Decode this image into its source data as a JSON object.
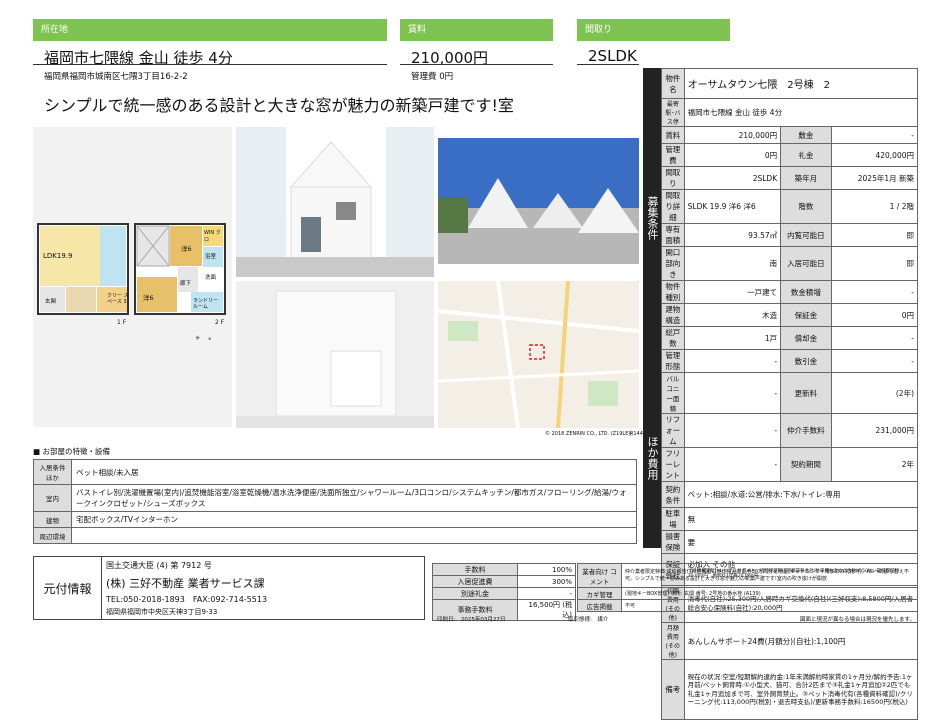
{
  "header": {
    "location_tab": "所在地",
    "rent_tab": "賃料",
    "layout_tab": "間取り",
    "station": "福岡市七隈線 金山 徒歩 4分",
    "address": "福岡県福岡市城南区七隈3丁目16-2-2",
    "rent": "210,000円",
    "mgmt_fee": "管理費 0円",
    "layout": "2SLDK",
    "catch_copy": "シンプルで統一感のある設計と大きな窓が魅力の新築戸建です!室"
  },
  "floorplan": {
    "ldk": "LDK19.9",
    "room_a": "洋6",
    "room_b": "洋6",
    "win": "WIN クロ",
    "bath": "浴室",
    "lav": "洗面",
    "hall": "廊下",
    "laundry": "ランドリー ルーム",
    "closet": "クリー スペース 3",
    "entrance": "玄関",
    "floor1": "1 F",
    "floor2": "2 F"
  },
  "map": {
    "copyright": "© 2018 ZENRIN CO., LTD. (Z19LE第1442号)"
  },
  "spec_labels": {
    "property_name": "物件名",
    "station": "最寄駅･バス停",
    "rent": "賃料",
    "deposit": "敷金",
    "mgmt": "管理費",
    "key_money": "礼金",
    "layout": "間取り",
    "built": "築年月",
    "layout_detail": "間取り詳細",
    "floor": "階数",
    "area": "専有面積",
    "preview": "内覧可能日",
    "opening": "開口部向き",
    "move_in": "入居可能日",
    "type": "物件種別",
    "units": "数金積増",
    "structure": "建物構造",
    "guarantee": "保証金",
    "total_units": "総戸数",
    "amortize": "償却金",
    "mgmt_form": "管理形態",
    "deduction": "敷引金",
    "balcony": "バルコニー面積",
    "renewal_fee": "更新料",
    "reform": "リフォーム",
    "brokerage": "仲介手数料",
    "free_rent": "フリーレント",
    "contract_period": "契約期間",
    "contract_terms": "契約条件",
    "parking": "駐車場",
    "insurance": "損害保険",
    "guarantor": "保証会社",
    "initial_cost": "初期費用(その他)",
    "monthly_cost": "月額費用(その他)",
    "remarks": "備考",
    "recruit_terms": "募集条件",
    "other_costs": "ほか費用"
  },
  "spec": {
    "property_name": "オーサムタウン七隈　2号棟　2",
    "station": "福岡市七隈線 金山 徒歩 4分",
    "rent": "210,000円",
    "deposit": "-",
    "mgmt": "0円",
    "key_money": "420,000円",
    "layout": "2SLDK",
    "built": "2025年1月 新築",
    "layout_detail": "SLDK 19.9 洋6 洋6",
    "floor": "1 / 2階",
    "area": "93.57㎡",
    "preview": "即",
    "opening": "南",
    "move_in": "即",
    "type": "一戸建て",
    "units": "-",
    "structure": "木造",
    "guarantee": "0円",
    "total_units": "1戸",
    "amortize": "-",
    "mgmt_form": "-",
    "deduction": "-",
    "balcony": "-",
    "renewal_fee": "(2年)",
    "reform": "-",
    "brokerage": "231,000円",
    "free_rent": "-",
    "contract_period": "2年",
    "contract_terms": "ペット:相談/水道:公営/排水:下水/トイレ:専用",
    "parking": "無",
    "insurance": "要",
    "guarantor": "必加入 その他",
    "guarantor_note": "【総額保証料】レジアルサポート：初回保証料は月額賃料合計(駐車場も含めた合計)の50%、最低保証料30,000円　更新料1年毎20,000円",
    "initial_cost": "消毒代(自社):25,300円/入居時カギ交換代(自社)(三好収支):8,5800円/入居者総合安心保険料(自社):20,000円",
    "monthly_cost": "あんしんサポート24費(月額分)(自社):1,100円",
    "remarks": "現在の状況:空室/短期解約違約金:1年未満解約時家賃の1ヶ月分/解約予告:1ヶ月前/ペット飼育時:①小型犬、猫可、合計2匹まで③礼金1ヶ月追加②2匹でも礼金1ヶ月追加まで可、室外飼育禁止。③ペット消毒代有(各種資料確認)/クリーニング代:113,000円(税別・退去時支払)/更新事務手数料:16500円(税込)"
  },
  "features": {
    "heading": "■ お部屋の特徴・設備",
    "rows": [
      {
        "label": "入居条件ほか",
        "value": "ペット相談/未入居"
      },
      {
        "label": "室内",
        "value": "バストイレ別/洗濯機置場(室内)/追焚機能浴室/浴室乾燥機/温水洗浄便座/洗面所独立/シャワールーム/3口コンロ/システムキッチン/都市ガス/フローリング/給湯/ウォークインクロゼット/シューズボックス"
      },
      {
        "label": "建物",
        "value": "宅配ボックス/TVインターホン"
      },
      {
        "label": "周辺環境",
        "value": ""
      }
    ]
  },
  "agent": {
    "label": "元付情報",
    "license": "国土交通大臣 (4) 第 7912 号",
    "company": "(株) 三好不動産 業者サービス課",
    "tel": "TEL:050-2018-1893　FAX:092-714-5513",
    "address": "福岡県福岡市中央区天神3丁目9-33"
  },
  "fees": [
    {
      "label": "手数料",
      "value": "100%"
    },
    {
      "label": "入居促進費",
      "value": "300%"
    },
    {
      "label": "別途礼金",
      "value": "-"
    },
    {
      "label": "事務手数料",
      "value": "16,500円 (税込)"
    }
  ],
  "notes": [
    {
      "label": "業者向け コメント",
      "value": "仲介業者限定特典:成約報告付け告報者に無印良品商品券30万円分を贈呈(キャナルシティ博多のみ利用可)。ADへの振り替え不可。シンプルで統一感のある設計と大きな窓が魅力の新築戸建です!室内の吹き抜けが開放"
    },
    {
      "label": "カギ管理",
      "value": "(現地キーBOX管理) 場所: 玄関 番号: 2号地の番水栓 (A139)"
    },
    {
      "label": "広告掲載",
      "value": "不可"
    }
  ],
  "footer": {
    "print_date": "印刷日:　2025年03月27日",
    "deal_type": "取引態様:　媒介",
    "disclaimer": "図面と現況が異なる場合は現況を優先します。"
  }
}
